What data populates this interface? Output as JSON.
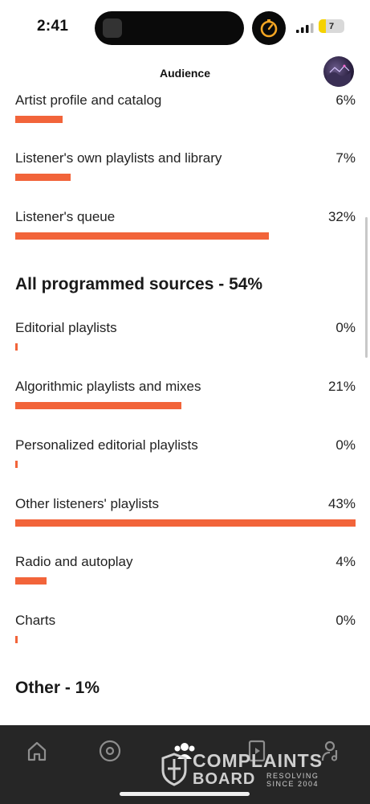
{
  "status_bar": {
    "time": "2:41",
    "battery": "7"
  },
  "header": {
    "title": "Audience"
  },
  "rows": [
    {
      "label": "Artist profile and catalog",
      "percent": "6%",
      "value": 6
    },
    {
      "label": "Listener's own playlists and library",
      "percent": "7%",
      "value": 7
    },
    {
      "label": "Listener's queue",
      "percent": "32%",
      "value": 32
    },
    {
      "label": "Editorial playlists",
      "percent": "0%",
      "value": 0
    },
    {
      "label": "Algorithmic playlists and mixes",
      "percent": "21%",
      "value": 21
    },
    {
      "label": "Personalized editorial playlists",
      "percent": "0%",
      "value": 0
    },
    {
      "label": "Other listeners' playlists",
      "percent": "43%",
      "value": 43
    },
    {
      "label": "Radio and autoplay",
      "percent": "4%",
      "value": 4
    },
    {
      "label": "Charts",
      "percent": "0%",
      "value": 0
    }
  ],
  "sections": {
    "programmed": "All programmed sources - 54%",
    "other": "Other - 1%"
  },
  "bar_color": "#f2643a",
  "nav": {
    "items": [
      {
        "icon": "home-icon"
      },
      {
        "icon": "music-disc-icon"
      },
      {
        "icon": "audience-icon"
      },
      {
        "icon": "media-play-icon"
      },
      {
        "icon": "profile-music-icon"
      }
    ]
  },
  "watermark": {
    "line1": "COMPLAINTS",
    "line2": "BOARD",
    "tag1": "RESOLVING",
    "tag2": "SINCE 2004"
  }
}
